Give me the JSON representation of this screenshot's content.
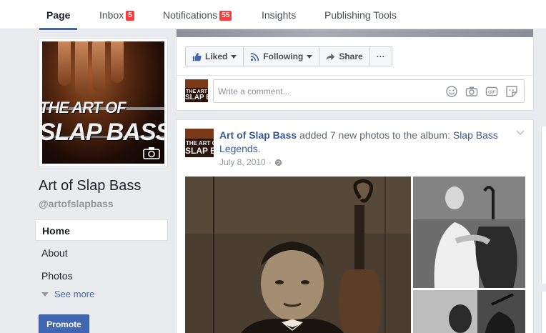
{
  "topbar": {
    "tabs": [
      {
        "label": "Page",
        "badge": null
      },
      {
        "label": "Inbox",
        "badge": "5"
      },
      {
        "label": "Notifications",
        "badge": "55"
      },
      {
        "label": "Insights",
        "badge": null
      },
      {
        "label": "Publishing Tools",
        "badge": null
      }
    ]
  },
  "profile": {
    "name": "Art of Slap Bass",
    "handle": "@artofslapbass",
    "art_line1": "THE ART OF",
    "art_line2": "SLAP BASS"
  },
  "sidebar": {
    "items": [
      {
        "label": "Home"
      },
      {
        "label": "About"
      },
      {
        "label": "Photos"
      }
    ],
    "see_more": "See more",
    "promote": "Promote"
  },
  "actions": {
    "liked": "Liked",
    "following": "Following",
    "share": "Share",
    "more": "···"
  },
  "comment": {
    "placeholder": "Write a comment..."
  },
  "post": {
    "author": "Art of Slap Bass",
    "action_text": " added 7 new photos to the album: ",
    "album": "Slap Bass Legends",
    "album_suffix": ".",
    "date": "July 8, 2010",
    "separator": "·",
    "privacy_icon": "globe-icon"
  },
  "colors": {
    "accent": "#4267b2",
    "link": "#365899",
    "badge": "#fa3e3e",
    "background": "#e9ebee"
  }
}
